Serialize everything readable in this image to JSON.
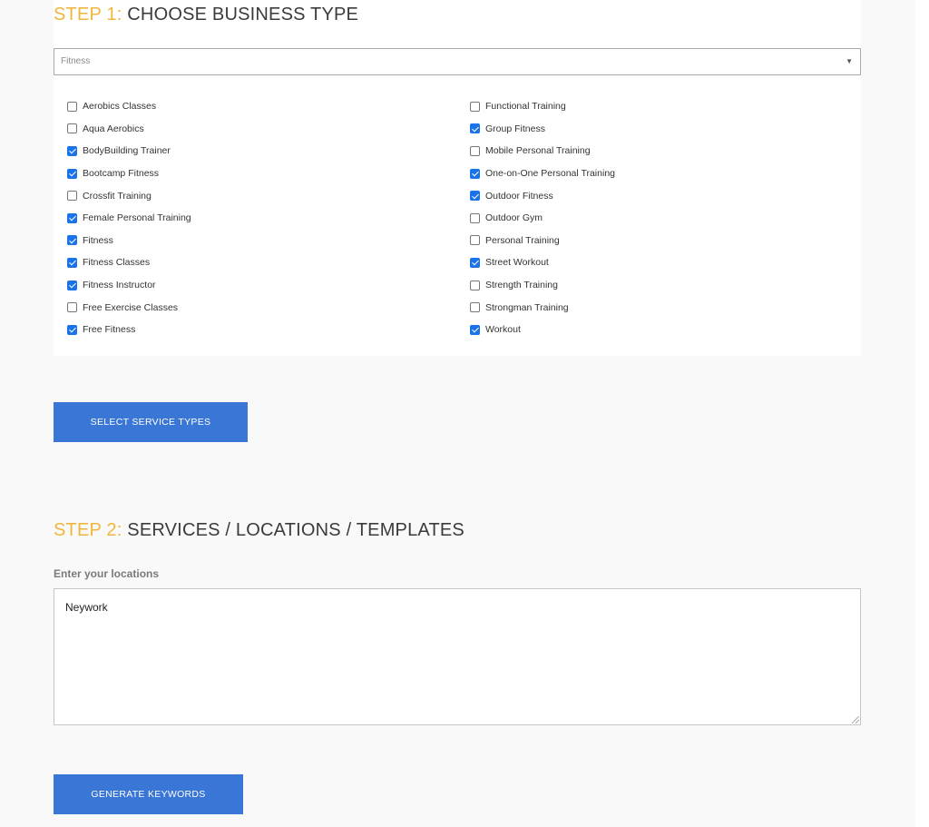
{
  "step1": {
    "step_label": "STEP 1:",
    "title": "CHOOSE BUSINESS TYPE",
    "business_type_select": {
      "selected": "Fitness",
      "arrow_icon": "caret-down-icon"
    },
    "service_types_left": [
      {
        "label": "Aerobics Classes",
        "checked": false
      },
      {
        "label": "Aqua Aerobics",
        "checked": false
      },
      {
        "label": "BodyBuilding Trainer",
        "checked": true
      },
      {
        "label": "Bootcamp Fitness",
        "checked": true
      },
      {
        "label": "Crossfit Training",
        "checked": false
      },
      {
        "label": "Female Personal Training",
        "checked": true
      },
      {
        "label": "Fitness",
        "checked": true
      },
      {
        "label": "Fitness Classes",
        "checked": true
      },
      {
        "label": "Fitness Instructor",
        "checked": true
      },
      {
        "label": "Free Exercise Classes",
        "checked": false
      },
      {
        "label": "Free Fitness",
        "checked": true
      }
    ],
    "service_types_right": [
      {
        "label": "Functional Training",
        "checked": false
      },
      {
        "label": "Group Fitness",
        "checked": true
      },
      {
        "label": "Mobile Personal Training",
        "checked": false
      },
      {
        "label": "One-on-One Personal Training",
        "checked": true
      },
      {
        "label": "Outdoor Fitness",
        "checked": true
      },
      {
        "label": "Outdoor Gym",
        "checked": false
      },
      {
        "label": "Personal Training",
        "checked": false
      },
      {
        "label": "Street Workout",
        "checked": true
      },
      {
        "label": "Strength Training",
        "checked": false
      },
      {
        "label": "Strongman Training",
        "checked": false
      },
      {
        "label": "Workout",
        "checked": true
      }
    ],
    "select_service_types_button": "SELECT SERVICE TYPES"
  },
  "step2": {
    "step_label": "STEP 2:",
    "title": "SERVICES / LOCATIONS / TEMPLATES",
    "locations_label": "Enter your locations",
    "locations_value": "Neywork",
    "generate_keywords_button": "GENERATE KEYWORDS"
  },
  "colors": {
    "step_accent": "#f0b63b",
    "button_blue": "#3a76d6",
    "checkbox_blue": "#1a73e8",
    "title_text": "#3b3b3b"
  }
}
